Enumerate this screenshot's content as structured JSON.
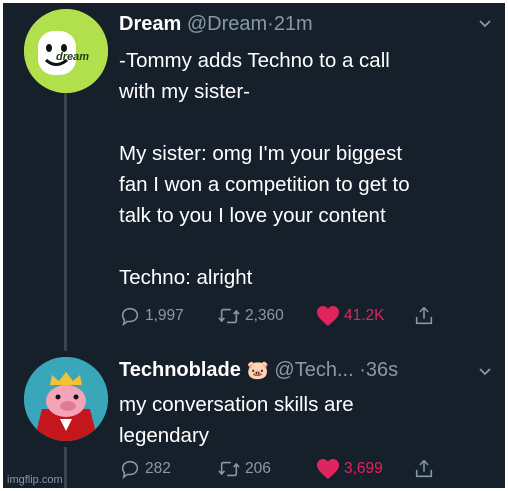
{
  "tweets": [
    {
      "author_name": "Dream",
      "handle": "@Dream",
      "separator": "·",
      "time": "21m",
      "avatar_text": "dream",
      "text": "-Tommy adds Techno to a call\nwith my sister-\n\nMy sister: omg I'm your biggest\nfan I won a competition to get to\ntalk to you I love your content\n\nTechno: alright",
      "replies": "1,997",
      "retweets": "2,360",
      "likes": "41.2K"
    },
    {
      "author_name": "Technoblade",
      "name_emoji": "🐷",
      "handle": "@Tech...",
      "separator": "·",
      "time": "36s",
      "text": "my conversation skills are\nlegendary",
      "replies": "282",
      "retweets": "206",
      "likes": "3,699"
    }
  ],
  "watermark": "imgflip.com",
  "colors": {
    "background": "#15202b",
    "text": "#ffffff",
    "secondary": "#8899a6",
    "like": "#e0245e",
    "thread_line": "#38444d"
  },
  "icons": [
    "reply-icon",
    "retweet-icon",
    "heart-icon",
    "share-icon",
    "chevron-down-icon",
    "crown-icon"
  ]
}
